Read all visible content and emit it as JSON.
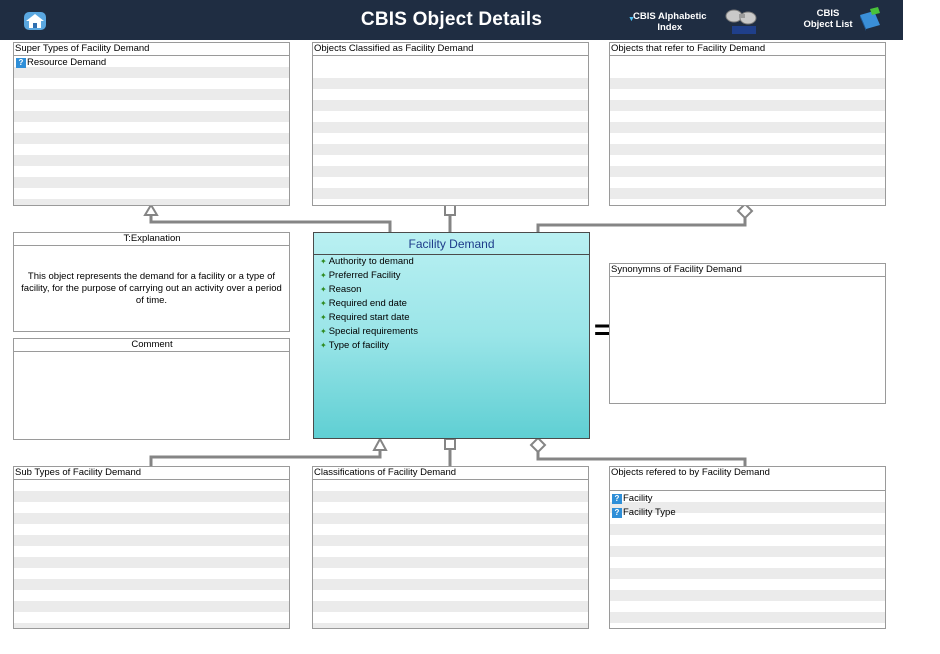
{
  "header": {
    "title": "CBIS Object Details",
    "alpha_index_line1": "CBIS Alphabetic",
    "alpha_index_line2": "Index",
    "object_list_line1": "CBIS",
    "object_list_line2": "Object List",
    "bg_color": "#1f2d42"
  },
  "panels": {
    "super_types": {
      "title": "Super Types of Facility Demand",
      "items": [
        "Resource Demand"
      ]
    },
    "classified_as": {
      "title": "Objects Classified as  Facility Demand",
      "items": []
    },
    "refer_to": {
      "title": "Objects that refer to   Facility Demand",
      "items": []
    },
    "explanation": {
      "title": "T:Explanation",
      "text": "This object represents the demand for a facility or a type of facility, for the purpose of carrying out an activity over a period of time."
    },
    "comment": {
      "title": "Comment"
    },
    "synonyms": {
      "title": "Synonymns  of Facility Demand"
    },
    "sub_types": {
      "title": "Sub Types of Facility Demand",
      "items": []
    },
    "classifications": {
      "title": "Classifications of  Facility Demand",
      "items": []
    },
    "referred_by": {
      "title": "Objects refered to by   Facility Demand",
      "items": [
        "Facility",
        "Facility Type"
      ]
    }
  },
  "center": {
    "title": "Facility Demand",
    "attributes": [
      "Authority to demand",
      "Preferred Facility",
      "Reason",
      "Required end date",
      "Required start date",
      "Special requirements",
      "Type of facility"
    ],
    "title_color": "#1d3b8a"
  },
  "symbols": {
    "equals": "="
  },
  "icons": [
    "home-icon",
    "binoculars-icon",
    "book-icon",
    "question-icon",
    "leaf-icon"
  ]
}
